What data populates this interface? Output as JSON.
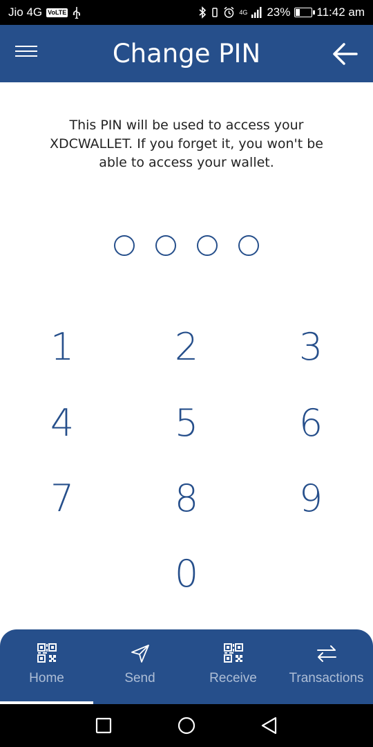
{
  "status_bar": {
    "carrier": "Jio 4G",
    "volte": "VoLTE",
    "network": "4G",
    "battery_percent": "23%",
    "time": "11:42 am"
  },
  "app_bar": {
    "title": "Change PIN"
  },
  "description": "This PIN will be used to access your XDCWALLET. If you forget it, you won't be able to access your wallet.",
  "pin_length": 4,
  "keypad": [
    "1",
    "2",
    "3",
    "4",
    "5",
    "6",
    "7",
    "8",
    "9",
    "0"
  ],
  "bottom_nav": {
    "items": [
      {
        "label": "Home",
        "icon": "qr-code-icon",
        "active": true
      },
      {
        "label": "Send",
        "icon": "send-icon",
        "active": false
      },
      {
        "label": "Receive",
        "icon": "qr-code-icon",
        "active": false
      },
      {
        "label": "Transactions",
        "icon": "transfer-arrows-icon",
        "active": false
      }
    ]
  },
  "colors": {
    "primary": "#264f8b",
    "nav_label": "#aebed6",
    "status_bar": "#000000"
  }
}
